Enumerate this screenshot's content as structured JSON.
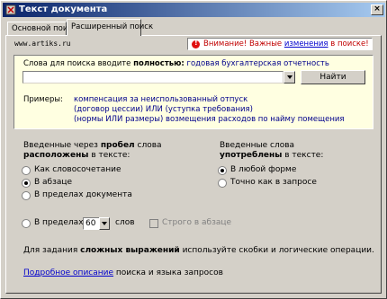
{
  "window": {
    "title": "Текст документа",
    "close_glyph": "×"
  },
  "tabs": [
    {
      "label": "Основной поиск",
      "active": false
    },
    {
      "label": "Расширенный поиск",
      "active": true
    }
  ],
  "site": "www.artiks.ru",
  "warning": {
    "prefix": "Внимание! Важные ",
    "link": "изменения",
    "suffix": " в поиске!",
    "text_color": "#c00000",
    "link_color": "#0000cc"
  },
  "search": {
    "hint_prefix": "Слова для поиска вводите ",
    "hint_strong": "полностью:",
    "hint_example": "годовая бухгалтерская отчетность",
    "input_value": "",
    "find_label": "Найти",
    "box_color": "#ffffe1"
  },
  "examples": {
    "label": "Примеры:",
    "lines": [
      "компенсация за неиспользованный отпуск",
      "(договор цессии) ИЛИ (уступка требования)",
      "(нормы ИЛИ размеры) возмещения расходов по найму помещения"
    ]
  },
  "placement": {
    "title_line1_a": "Введенные через ",
    "title_line1_b": "пробел",
    "title_line1_c": " слова",
    "title_line2_a": "расположены",
    "title_line2_b": " в тексте:",
    "options": [
      {
        "label": "Как словосочетание",
        "selected": false
      },
      {
        "label": "В абзаце",
        "selected": true
      },
      {
        "label": "В пределах документа",
        "selected": false
      }
    ]
  },
  "usage": {
    "title_line1": "Введенные слова",
    "title_line2_a": "употреблены",
    "title_line2_b": " в тексте:",
    "options": [
      {
        "label": "В любой форме",
        "selected": true
      },
      {
        "label": "Точно как в запросе",
        "selected": false
      }
    ]
  },
  "within": {
    "label": "В пределах",
    "value": "60",
    "unit": "слов",
    "checkbox_label": "Строго в абзаце",
    "checkbox_enabled": false
  },
  "note": {
    "prefix": "Для задания ",
    "strong": "сложных выражений",
    "suffix": " используйте скобки и логические операции."
  },
  "doc": {
    "link": "Подробное описание",
    "suffix": " поиска и языка запросов"
  }
}
